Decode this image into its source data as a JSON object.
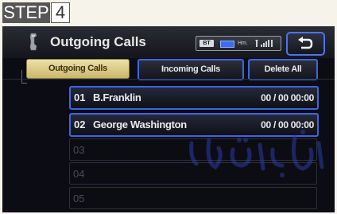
{
  "step": {
    "label": "STEP",
    "number": "4"
  },
  "screen": {
    "title": "Outgoing Calls",
    "status": {
      "bt_label": "BT",
      "carrier": "Hm."
    },
    "tabs": [
      {
        "label": "Outgoing Calls",
        "selected": true
      },
      {
        "label": "Incoming Calls",
        "selected": false
      },
      {
        "label": "Delete All",
        "selected": false
      }
    ],
    "rows": [
      {
        "index": "01",
        "name": "B.Franklin",
        "time": "00 / 00 00:00"
      },
      {
        "index": "02",
        "name": "George Washington",
        "time": "00 / 00 00:00"
      },
      {
        "index": "03",
        "name": "",
        "time": ""
      },
      {
        "index": "04",
        "name": "",
        "time": ""
      },
      {
        "index": "05",
        "name": "",
        "time": ""
      }
    ]
  },
  "colors": {
    "accent_blue": "#3f66e0",
    "selected_tab": "#ddc985",
    "screen_bg": "#0b0c14",
    "step_bg": "#565656"
  },
  "icons": [
    "phone-icon",
    "bluetooth-icon",
    "battery-icon",
    "signal-icon",
    "back-arrow-icon"
  ]
}
